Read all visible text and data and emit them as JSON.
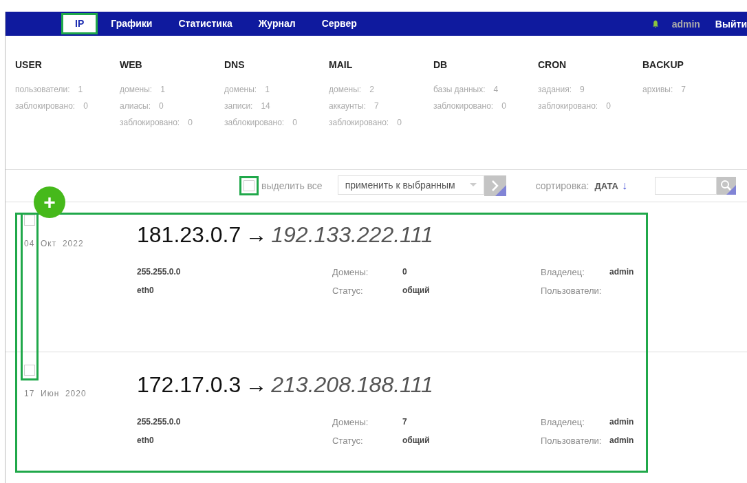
{
  "nav": {
    "tabs": [
      {
        "label": "IP",
        "selected": true
      },
      {
        "label": "Графики",
        "selected": false
      },
      {
        "label": "Статистика",
        "selected": false
      },
      {
        "label": "Журнал",
        "selected": false
      },
      {
        "label": "Сервер",
        "selected": false
      }
    ],
    "user": "admin",
    "logout": "Выйти"
  },
  "stats": [
    {
      "title": "USER",
      "items": [
        {
          "label": "пользователи:",
          "value": "1"
        },
        {
          "label": "заблокировано:",
          "value": "0"
        }
      ]
    },
    {
      "title": "WEB",
      "items": [
        {
          "label": "домены:",
          "value": "1"
        },
        {
          "label": "алиасы:",
          "value": "0"
        },
        {
          "label": "заблокировано:",
          "value": "0"
        }
      ]
    },
    {
      "title": "DNS",
      "items": [
        {
          "label": "домены:",
          "value": "1"
        },
        {
          "label": "записи:",
          "value": "14"
        },
        {
          "label": "заблокировано:",
          "value": "0"
        }
      ]
    },
    {
      "title": "MAIL",
      "items": [
        {
          "label": "домены:",
          "value": "2"
        },
        {
          "label": "аккаунты:",
          "value": "7"
        },
        {
          "label": "заблокировано:",
          "value": "0"
        }
      ]
    },
    {
      "title": "DB",
      "items": [
        {
          "label": "базы данных:",
          "value": "4"
        },
        {
          "label": "заблокировано:",
          "value": "0"
        }
      ]
    },
    {
      "title": "CRON",
      "items": [
        {
          "label": "задания:",
          "value": "9"
        },
        {
          "label": "заблокировано:",
          "value": "0"
        }
      ]
    },
    {
      "title": "BACKUP",
      "items": [
        {
          "label": "архивы:",
          "value": "7"
        }
      ]
    }
  ],
  "toolbar": {
    "add_button": "+",
    "select_all": {
      "label": "выделить все",
      "checked": false
    },
    "bulk_action": "применить к выбранным",
    "sort": {
      "label": "сортировка:",
      "value": "ДАТА",
      "arrow": "↓"
    }
  },
  "rows": [
    {
      "checked": false,
      "day": "04",
      "month": "Окт",
      "year": "2022",
      "ip": "181.23.0.7",
      "arrow": "→",
      "nat": "192.133.222.111",
      "netmask": "255.255.0.0",
      "interface": "eth0",
      "fields": [
        {
          "label": "Домены:",
          "value": "0"
        },
        {
          "label": "Владелец:",
          "value": "admin"
        },
        {
          "label": "Статус:",
          "value": "общий"
        },
        {
          "label": "Пользователи:"
        }
      ]
    },
    {
      "checked": false,
      "day": "17",
      "month": "Июн",
      "year": "2020",
      "ip": "172.17.0.3",
      "arrow": "→",
      "nat": "213.208.188.111",
      "netmask": "255.255.0.0",
      "interface": "eth0",
      "fields": [
        {
          "label": "Домены:",
          "value": "7"
        },
        {
          "label": "Владелец:",
          "value": "admin"
        },
        {
          "label": "Статус:",
          "value": "общий"
        },
        {
          "label": "Пользователи:",
          "value": "admin"
        }
      ]
    }
  ]
}
